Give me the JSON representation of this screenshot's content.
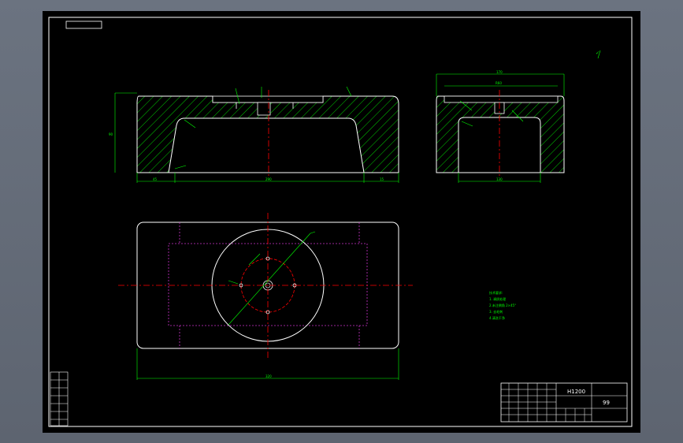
{
  "drawing": {
    "title_block_name": "H1200",
    "title_block_sheet": "99",
    "notes_lines": [
      "技术要求:",
      "1. 调质处理",
      "2.未注倒角 2×45°",
      "3. 去毛刺",
      "4.清洗干净"
    ],
    "colors": {
      "background": "#000000",
      "outline": "#ffffff",
      "dimension": "#00ff00",
      "centerline": "#ff0000",
      "hidden": "#cc33cc",
      "frame": "#ffffff"
    },
    "dims": {
      "front_width": "290",
      "front_left_seg": "45",
      "front_right_seg": "15",
      "front_height": "90",
      "side_top_overall": "170",
      "side_top_inner": "R60",
      "side_bottom": "130",
      "plan_width": "320"
    }
  }
}
